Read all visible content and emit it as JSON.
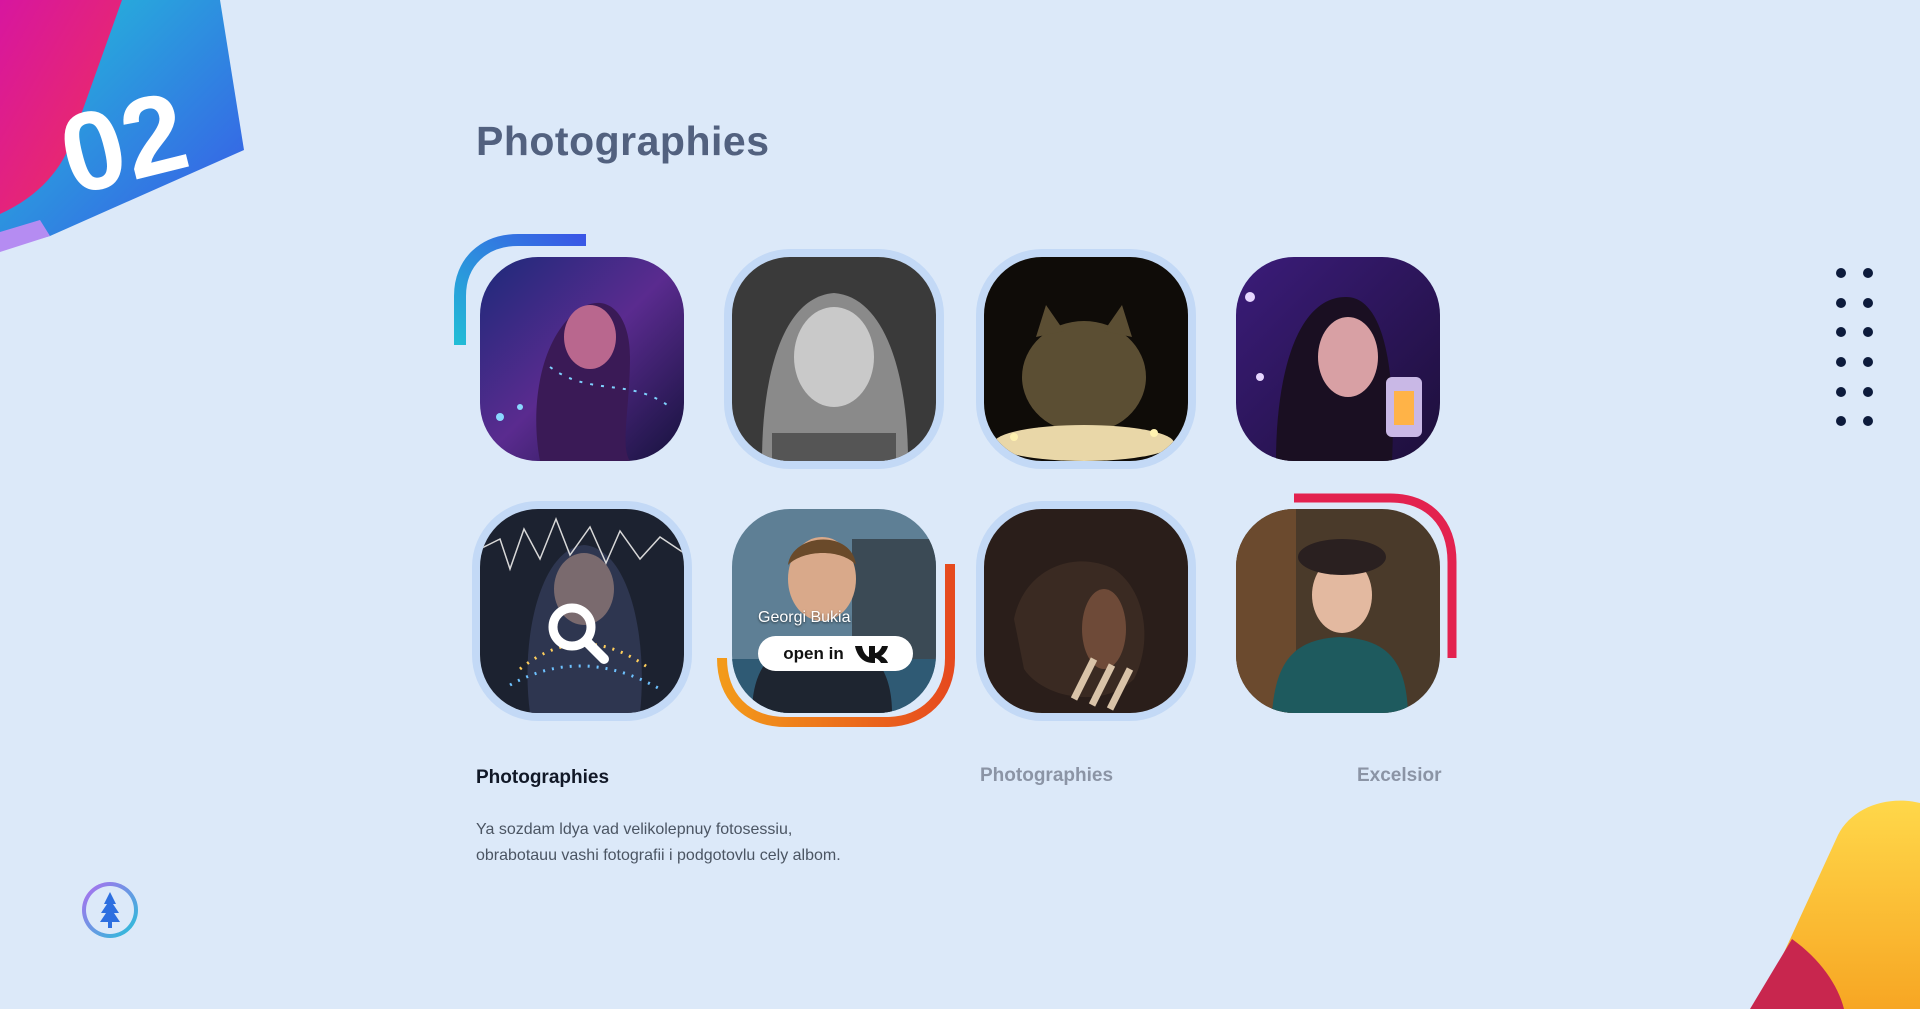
{
  "section": {
    "number": "02",
    "title": "Photographies"
  },
  "colors": {
    "background": "#dce9f9",
    "title": "#52617f",
    "ring": "#c3d9f6",
    "dots": "#0d1b3c",
    "accent_blue": "#3d5be6",
    "accent_pink": "#e0157f",
    "accent_orange": "#f08a1c",
    "accent_red": "#e3224f"
  },
  "gallery": {
    "photos": [
      {
        "subject": "girl-with-fairy-lights"
      },
      {
        "subject": "bw-portrait-woman"
      },
      {
        "subject": "cat-with-lights"
      },
      {
        "subject": "woman-with-lantern"
      },
      {
        "subject": "girl-with-light-garland",
        "overlay_icon": "search-icon"
      },
      {
        "subject": "young-man-portrait",
        "person_name": "Georgi Bukia",
        "open_label": "open in",
        "network_icon": "vk-icon"
      },
      {
        "subject": "dark-profile-portrait"
      },
      {
        "subject": "woman-in-beret"
      }
    ]
  },
  "captions": {
    "first": "Photographies",
    "second": "Photographies",
    "third": "Excelsior"
  },
  "description": "Ya sozdam ldya vad velikolepnuy fotosessiu, obrabotauu vashi fotografii i podgotovlu cely albom.",
  "logo": {
    "icon": "tree-icon"
  }
}
